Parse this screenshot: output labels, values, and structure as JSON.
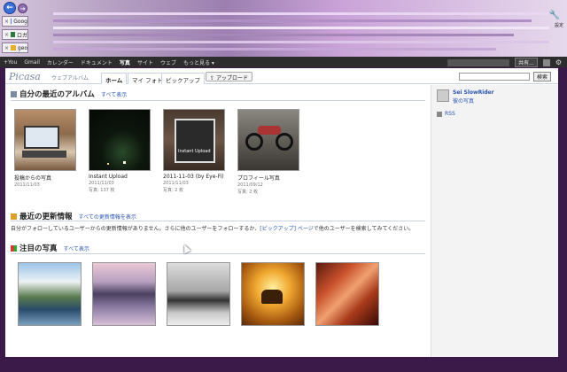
{
  "browser": {
    "tabs": [
      {
        "label": "Goog"
      },
      {
        "label": "ロガ"
      },
      {
        "label": "geo"
      }
    ],
    "settings_label": "設定"
  },
  "gbar": {
    "items": [
      "+You",
      "Gmail",
      "カレンダー",
      "ドキュメント",
      "写真",
      "サイト",
      "ウェブ",
      "もっと見る ▾"
    ],
    "active_index": 4,
    "share_label": "共有..."
  },
  "header": {
    "logo": "Picasa",
    "logo_sub": "ウェブアルバム",
    "tabs": [
      "ホーム",
      "マイ フォト",
      "ピックアップ"
    ],
    "upload_label": "アップロード",
    "search_button": "検索"
  },
  "recent_albums": {
    "title": "自分の最近のアルバム",
    "link": "すべて表示",
    "albums": [
      {
        "title": "投稿からの写真",
        "date": "2011/11/03",
        "meta": ""
      },
      {
        "title": "Instant Upload",
        "date": "2011/11/03",
        "meta": "写真: 137 枚"
      },
      {
        "title": "2011-11-03 (by Eye-Fi)",
        "date": "2011/11/03",
        "meta": "写真: 2 枚"
      },
      {
        "title": "プロフィール写真",
        "date": "2011/09/12",
        "meta": "写真: 2 枚"
      }
    ],
    "album_overlay": "Instant Upload"
  },
  "updates": {
    "title": "最近の更新情報",
    "link": "すべての更新情報を表示",
    "text_before": "自分がフォローしているユーザーからの更新情報がありません。さらに他のユーザーをフォローするか、",
    "text_link": "[ピックアップ] ページ",
    "text_after": "で他のユーザーを検索してみてください。"
  },
  "featured": {
    "title": "注目の写真",
    "link": "すべて表示"
  },
  "sidebar": {
    "user_name": "Sei SlowRider",
    "user_link": "彼の写真",
    "rss": "RSS"
  },
  "colors": {
    "accent": "#2a55b0",
    "gbar": "#2d2d2d",
    "frame": "#3b1a4a"
  }
}
